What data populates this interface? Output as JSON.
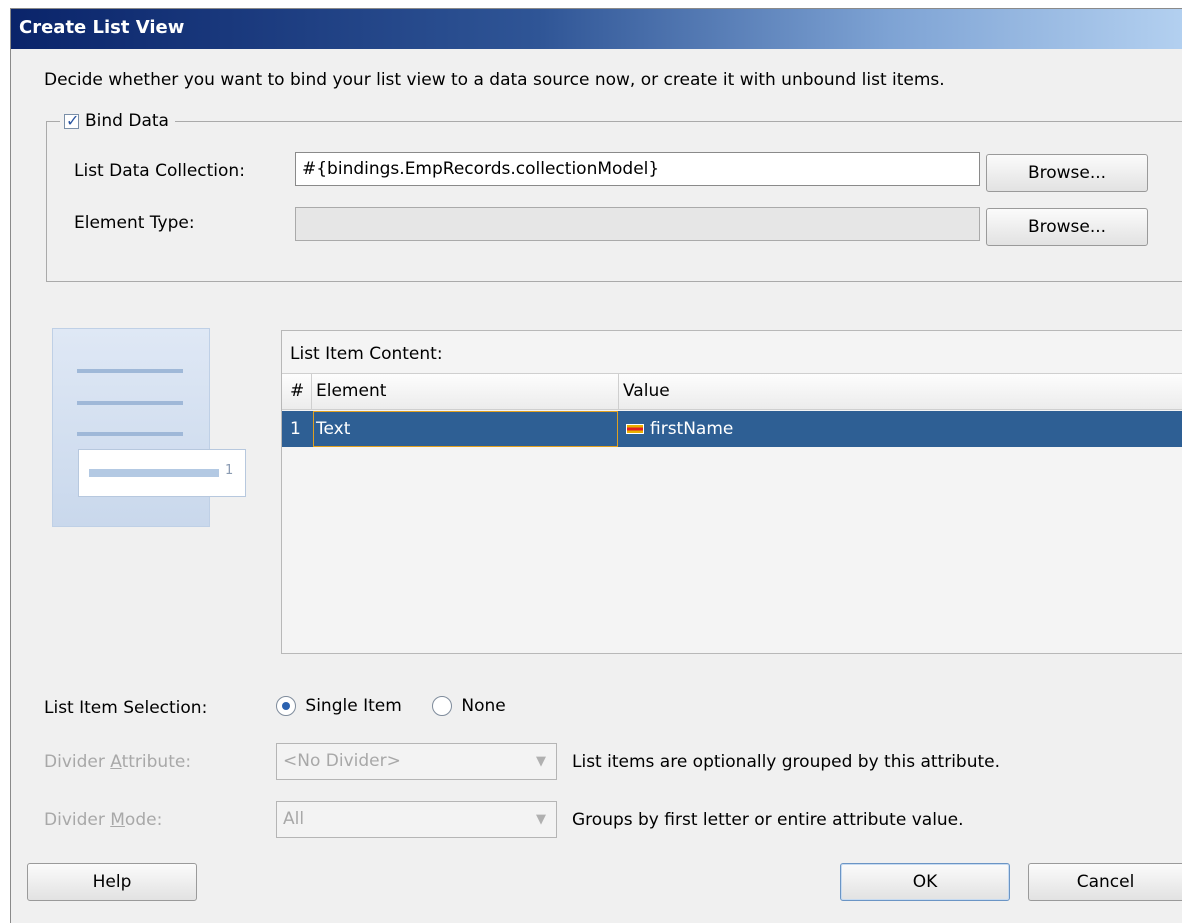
{
  "dialog": {
    "title": "Create List View",
    "description": "Decide whether you want to bind your list view to a data source now, or create it with unbound list items."
  },
  "bind_data": {
    "checkbox_label": "Bind Data",
    "checked": true,
    "list_data_collection": {
      "label": "List Data Collection:",
      "value": "#{bindings.EmpRecords.collectionModel}",
      "browse_label": "Browse..."
    },
    "element_type": {
      "label": "Element Type:",
      "value": "",
      "browse_label": "Browse..."
    }
  },
  "list_item_content": {
    "caption": "List Item Content:",
    "columns": [
      "#",
      "Element",
      "Value"
    ],
    "rows": [
      {
        "index": "1",
        "element": "Text",
        "value": "firstName",
        "value_icon": "attribute-icon"
      }
    ]
  },
  "preview": {
    "badge": "1"
  },
  "list_item_selection": {
    "label": "List Item Selection:",
    "options": [
      {
        "label": "Single Item",
        "selected": true
      },
      {
        "label": "None",
        "selected": false
      }
    ]
  },
  "divider_attribute": {
    "label": "Divider Attribute:",
    "value": "<No Divider>",
    "hint": "List items are optionally grouped by this attribute."
  },
  "divider_mode": {
    "label": "Divider Mode:",
    "value": "All",
    "hint": "Groups by first letter or entire attribute value."
  },
  "buttons": {
    "help": "Help",
    "ok": "OK",
    "cancel": "Cancel"
  },
  "colors": {
    "selected_row": "#2e5f94",
    "title_bar_start": "#0a246a",
    "dialog_bg": "#f0f0f0"
  }
}
